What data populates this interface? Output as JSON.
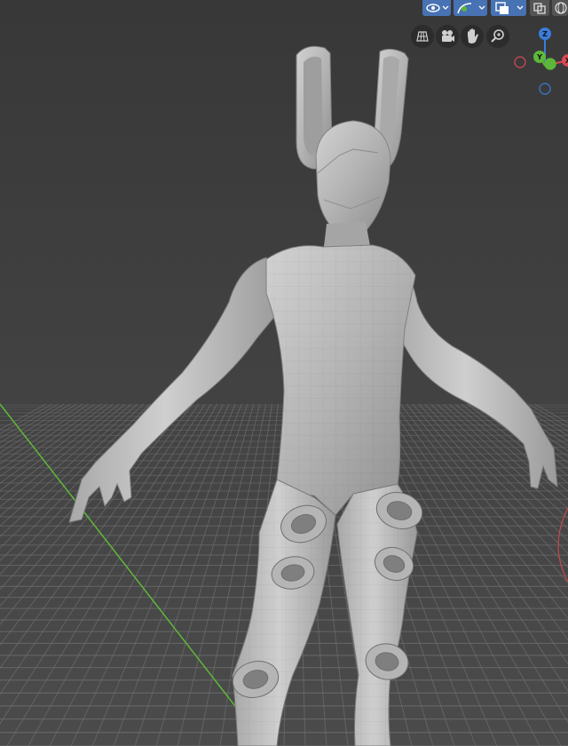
{
  "viewport": {
    "background_top": "#3a3a3a",
    "background_bottom": "#4a4a4a",
    "grid_color": "#6e6e6e",
    "y_axis_color": "#5db83a",
    "x_axis_color": "#c44a4a",
    "mesh_color": "#b9b9b9"
  },
  "header": {
    "buttons": [
      {
        "icon": "view-object-types-icon",
        "active": true
      },
      {
        "icon": "viewport-gizmos-icon",
        "active": true
      },
      {
        "icon": "overlays-icon",
        "active": true
      },
      {
        "icon": "xray-toggle-icon",
        "active": false
      },
      {
        "icon": "wireframe-shading-icon",
        "active": false
      }
    ]
  },
  "navigation": {
    "buttons": [
      {
        "name": "toggle-grid-view",
        "icon": "grid-icon"
      },
      {
        "name": "camera-view",
        "icon": "camera-icon"
      },
      {
        "name": "pan-view",
        "icon": "hand-icon"
      },
      {
        "name": "zoom-view",
        "icon": "zoom-icon"
      }
    ]
  },
  "gizmo": {
    "z_label": "Z",
    "y_label": "Y",
    "x_label": "X",
    "z_color": "#3b7ddb",
    "y_color": "#5db83a",
    "x_color": "#d84a55"
  }
}
